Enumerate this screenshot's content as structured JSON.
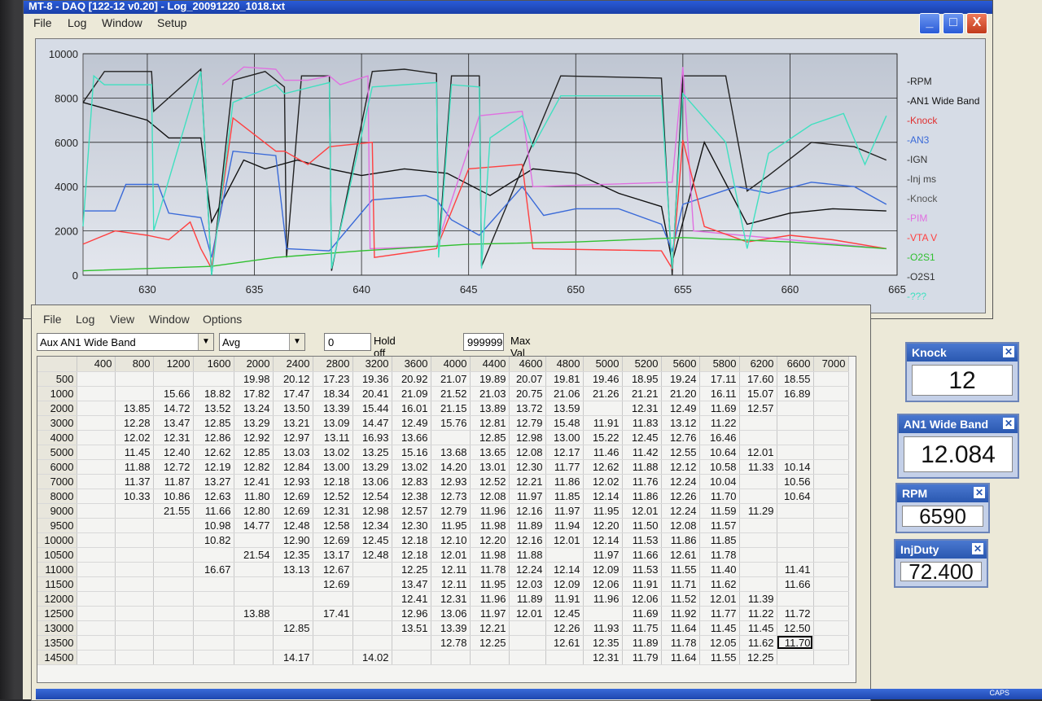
{
  "window": {
    "title": "MT-8 - DAQ [122-12 v0.20] - Log_20091220_1018.txt",
    "menu": [
      "File",
      "Log",
      "Window",
      "Setup"
    ],
    "buttons": [
      "_",
      "□",
      "X"
    ]
  },
  "chart_data": {
    "type": "line",
    "yticks": [
      "10000",
      "8000",
      "6000",
      "4000",
      "2000",
      "0"
    ],
    "ylim": [
      0,
      10000
    ],
    "xticks": [
      "630",
      "635",
      "640",
      "645",
      "650",
      "655",
      "660",
      "665"
    ],
    "xlim": [
      627,
      665
    ],
    "grid": true,
    "legend_position": "right",
    "series": [
      {
        "name": "RPM",
        "color": "#222222"
      },
      {
        "name": "AN1 Wide Band",
        "color": "#111111"
      },
      {
        "name": "Knock",
        "color": "#e03030"
      },
      {
        "name": "AN3",
        "color": "#3a6ad8"
      },
      {
        "name": "IGN",
        "color": "#333333"
      },
      {
        "name": "Inj ms",
        "color": "#444444"
      },
      {
        "name": "Knock",
        "color": "#555555"
      },
      {
        "name": "PIM",
        "color": "#e070e0"
      },
      {
        "name": "VTA V",
        "color": "#ff4040"
      },
      {
        "name": "O2S1",
        "color": "#30c030"
      },
      {
        "name": "O2S1",
        "color": "#333333"
      },
      {
        "name": "???",
        "color": "#40e0c0"
      }
    ]
  },
  "data_window": {
    "menu": [
      "File",
      "Log",
      "View",
      "Window",
      "Options"
    ],
    "channel_select": "Aux AN1 Wide Band",
    "mode_select": "Avg",
    "holdoff_value": "0",
    "holdoff_label": "Hold off (mSec)",
    "maxval_value": "999999",
    "maxval_label": "Max Val",
    "columns": [
      "",
      "400",
      "800",
      "1200",
      "1600",
      "2000",
      "2400",
      "2800",
      "3200",
      "3600",
      "4000",
      "4400",
      "4600",
      "4800",
      "5000",
      "5200",
      "5600",
      "5800",
      "6200",
      "6600",
      "7000"
    ],
    "rows": [
      [
        "500",
        "",
        "",
        "",
        "",
        "19.98",
        "20.12",
        "17.23",
        "19.36",
        "20.92",
        "21.07",
        "19.89",
        "20.07",
        "19.81",
        "19.46",
        "18.95",
        "19.24",
        "17.11",
        "17.60",
        "18.55",
        ""
      ],
      [
        "1000",
        "",
        "",
        "15.66",
        "18.82",
        "17.82",
        "17.47",
        "18.34",
        "20.41",
        "21.09",
        "21.52",
        "21.03",
        "20.75",
        "21.06",
        "21.26",
        "21.21",
        "21.20",
        "16.11",
        "15.07",
        "16.89",
        ""
      ],
      [
        "2000",
        "",
        "13.85",
        "14.72",
        "13.52",
        "13.24",
        "13.50",
        "13.39",
        "15.44",
        "16.01",
        "21.15",
        "13.89",
        "13.72",
        "13.59",
        "",
        "12.31",
        "12.49",
        "11.69",
        "12.57",
        "",
        ""
      ],
      [
        "3000",
        "",
        "12.28",
        "13.47",
        "12.85",
        "13.29",
        "13.21",
        "13.09",
        "14.47",
        "12.49",
        "15.76",
        "12.81",
        "12.79",
        "15.48",
        "11.91",
        "11.83",
        "13.12",
        "11.22",
        "",
        "",
        ""
      ],
      [
        "4000",
        "",
        "12.02",
        "12.31",
        "12.86",
        "12.92",
        "12.97",
        "13.11",
        "16.93",
        "13.66",
        "",
        "12.85",
        "12.98",
        "13.00",
        "15.22",
        "12.45",
        "12.76",
        "16.46",
        "",
        "",
        ""
      ],
      [
        "5000",
        "",
        "11.45",
        "12.40",
        "12.62",
        "12.85",
        "13.03",
        "13.02",
        "13.25",
        "15.16",
        "13.68",
        "13.65",
        "12.08",
        "12.17",
        "11.46",
        "11.42",
        "12.55",
        "10.64",
        "12.01",
        "",
        ""
      ],
      [
        "6000",
        "",
        "11.88",
        "12.72",
        "12.19",
        "12.82",
        "12.84",
        "13.00",
        "13.29",
        "13.02",
        "14.20",
        "13.01",
        "12.30",
        "11.77",
        "12.62",
        "11.88",
        "12.12",
        "10.58",
        "11.33",
        "10.14",
        ""
      ],
      [
        "7000",
        "",
        "11.37",
        "11.87",
        "13.27",
        "12.41",
        "12.93",
        "12.18",
        "13.06",
        "12.83",
        "12.93",
        "12.52",
        "12.21",
        "11.86",
        "12.02",
        "11.76",
        "12.24",
        "10.04",
        "",
        "10.56",
        ""
      ],
      [
        "8000",
        "",
        "10.33",
        "10.86",
        "12.63",
        "11.80",
        "12.69",
        "12.52",
        "12.54",
        "12.38",
        "12.73",
        "12.08",
        "11.97",
        "11.85",
        "12.14",
        "11.86",
        "12.26",
        "11.70",
        "",
        "10.64",
        ""
      ],
      [
        "9000",
        "",
        "",
        "21.55",
        "11.66",
        "12.80",
        "12.69",
        "12.31",
        "12.98",
        "12.57",
        "12.79",
        "11.96",
        "12.16",
        "11.97",
        "11.95",
        "12.01",
        "12.24",
        "11.59",
        "11.29",
        "",
        ""
      ],
      [
        "9500",
        "",
        "",
        "",
        "10.98",
        "14.77",
        "12.48",
        "12.58",
        "12.34",
        "12.30",
        "11.95",
        "11.98",
        "11.89",
        "11.94",
        "12.20",
        "11.50",
        "12.08",
        "11.57",
        "",
        "",
        ""
      ],
      [
        "10000",
        "",
        "",
        "",
        "10.82",
        "",
        "12.90",
        "12.69",
        "12.45",
        "12.18",
        "12.10",
        "12.20",
        "12.16",
        "12.01",
        "12.14",
        "11.53",
        "11.86",
        "11.85",
        "",
        "",
        ""
      ],
      [
        "10500",
        "",
        "",
        "",
        "",
        "21.54",
        "12.35",
        "13.17",
        "12.48",
        "12.18",
        "12.01",
        "11.98",
        "11.88",
        "",
        "11.97",
        "11.66",
        "12.61",
        "11.78",
        "",
        "",
        ""
      ],
      [
        "11000",
        "",
        "",
        "",
        "16.67",
        "",
        "13.13",
        "12.67",
        "",
        "12.25",
        "12.11",
        "11.78",
        "12.24",
        "12.14",
        "12.09",
        "11.53",
        "11.55",
        "11.40",
        "",
        "11.41",
        ""
      ],
      [
        "11500",
        "",
        "",
        "",
        "",
        "",
        "",
        "12.69",
        "",
        "13.47",
        "12.11",
        "11.95",
        "12.03",
        "12.09",
        "12.06",
        "11.91",
        "11.71",
        "11.62",
        "",
        "11.66",
        ""
      ],
      [
        "12000",
        "",
        "",
        "",
        "",
        "",
        "",
        "",
        "",
        "12.41",
        "12.31",
        "11.96",
        "11.89",
        "11.91",
        "11.96",
        "12.06",
        "11.52",
        "12.01",
        "11.39",
        "",
        ""
      ],
      [
        "12500",
        "",
        "",
        "",
        "",
        "13.88",
        "",
        "17.41",
        "",
        "12.96",
        "13.06",
        "11.97",
        "12.01",
        "12.45",
        "",
        "11.69",
        "11.92",
        "11.77",
        "11.22",
        "11.72",
        ""
      ],
      [
        "13000",
        "",
        "",
        "",
        "",
        "",
        "12.85",
        "",
        "",
        "13.51",
        "13.39",
        "12.21",
        "",
        "12.26",
        "11.93",
        "11.75",
        "11.64",
        "11.45",
        "11.45",
        "12.50",
        ""
      ],
      [
        "13500",
        "",
        "",
        "",
        "",
        "",
        "",
        "",
        "",
        "",
        "12.78",
        "12.25",
        "",
        "12.61",
        "12.35",
        "11.89",
        "11.78",
        "12.05",
        "11.62",
        "11.70",
        ""
      ],
      [
        "14500",
        "",
        "",
        "",
        "",
        "",
        "14.17",
        "",
        "14.02",
        "",
        "",
        "",
        "",
        "",
        "12.31",
        "11.79",
        "11.64",
        "11.55",
        "12.25",
        "",
        ""
      ]
    ]
  },
  "gauges": [
    {
      "title": "Knock",
      "value": "12"
    },
    {
      "title": "AN1 Wide Band",
      "value": "12.084"
    },
    {
      "title": "RPM",
      "value": "6590"
    },
    {
      "title": "InjDuty",
      "value": "72.400"
    }
  ],
  "taskbar": {
    "clock": "CAPS"
  }
}
